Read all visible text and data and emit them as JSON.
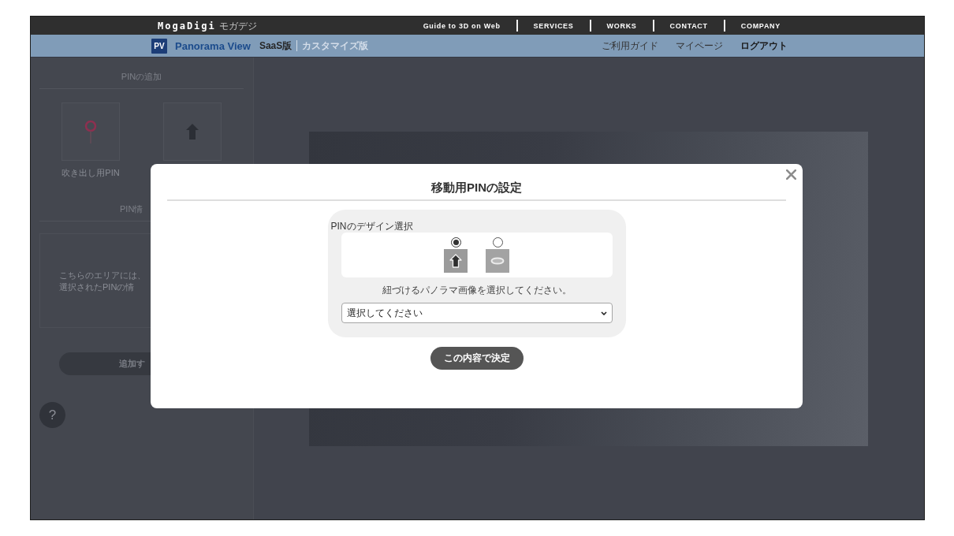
{
  "header": {
    "logo": "MogaDigi",
    "logo_kana": "モガデジ",
    "nav": [
      "Guide to 3D on Web",
      "SERVICES",
      "WORKS",
      "CONTACT",
      "COMPANY"
    ]
  },
  "sub_header": {
    "badge": "PV",
    "product": "Panorama View",
    "editions": [
      {
        "label": "SaaS版",
        "selected": true
      },
      {
        "label": "カスタマイズ版",
        "selected": false
      }
    ],
    "links": [
      {
        "label": "ご利用ガイド",
        "kind": "link"
      },
      {
        "label": "マイページ",
        "kind": "link"
      },
      {
        "label": "ログアウト",
        "kind": "logout"
      }
    ]
  },
  "sidebar": {
    "add_heading": "PINの追加",
    "pin_types": [
      {
        "kind": "balloon",
        "label": "吹き出し用PIN"
      },
      {
        "kind": "move"
      }
    ],
    "info_heading": "PIN情",
    "info_lines": [
      "こちらのエリアには、",
      "選択されたPINの情"
    ],
    "button": "追加す",
    "help": "?"
  },
  "dialog": {
    "title": "移動用PINの設定",
    "design_label": "PINのデザイン選択",
    "designs": [
      {
        "kind": "arrow",
        "selected": true
      },
      {
        "kind": "ring",
        "selected": false
      }
    ],
    "instruction": "紐づけるパノラマ画像を選択してください。",
    "select": {
      "value": "選択してください"
    },
    "confirm": "この内容で決定"
  }
}
